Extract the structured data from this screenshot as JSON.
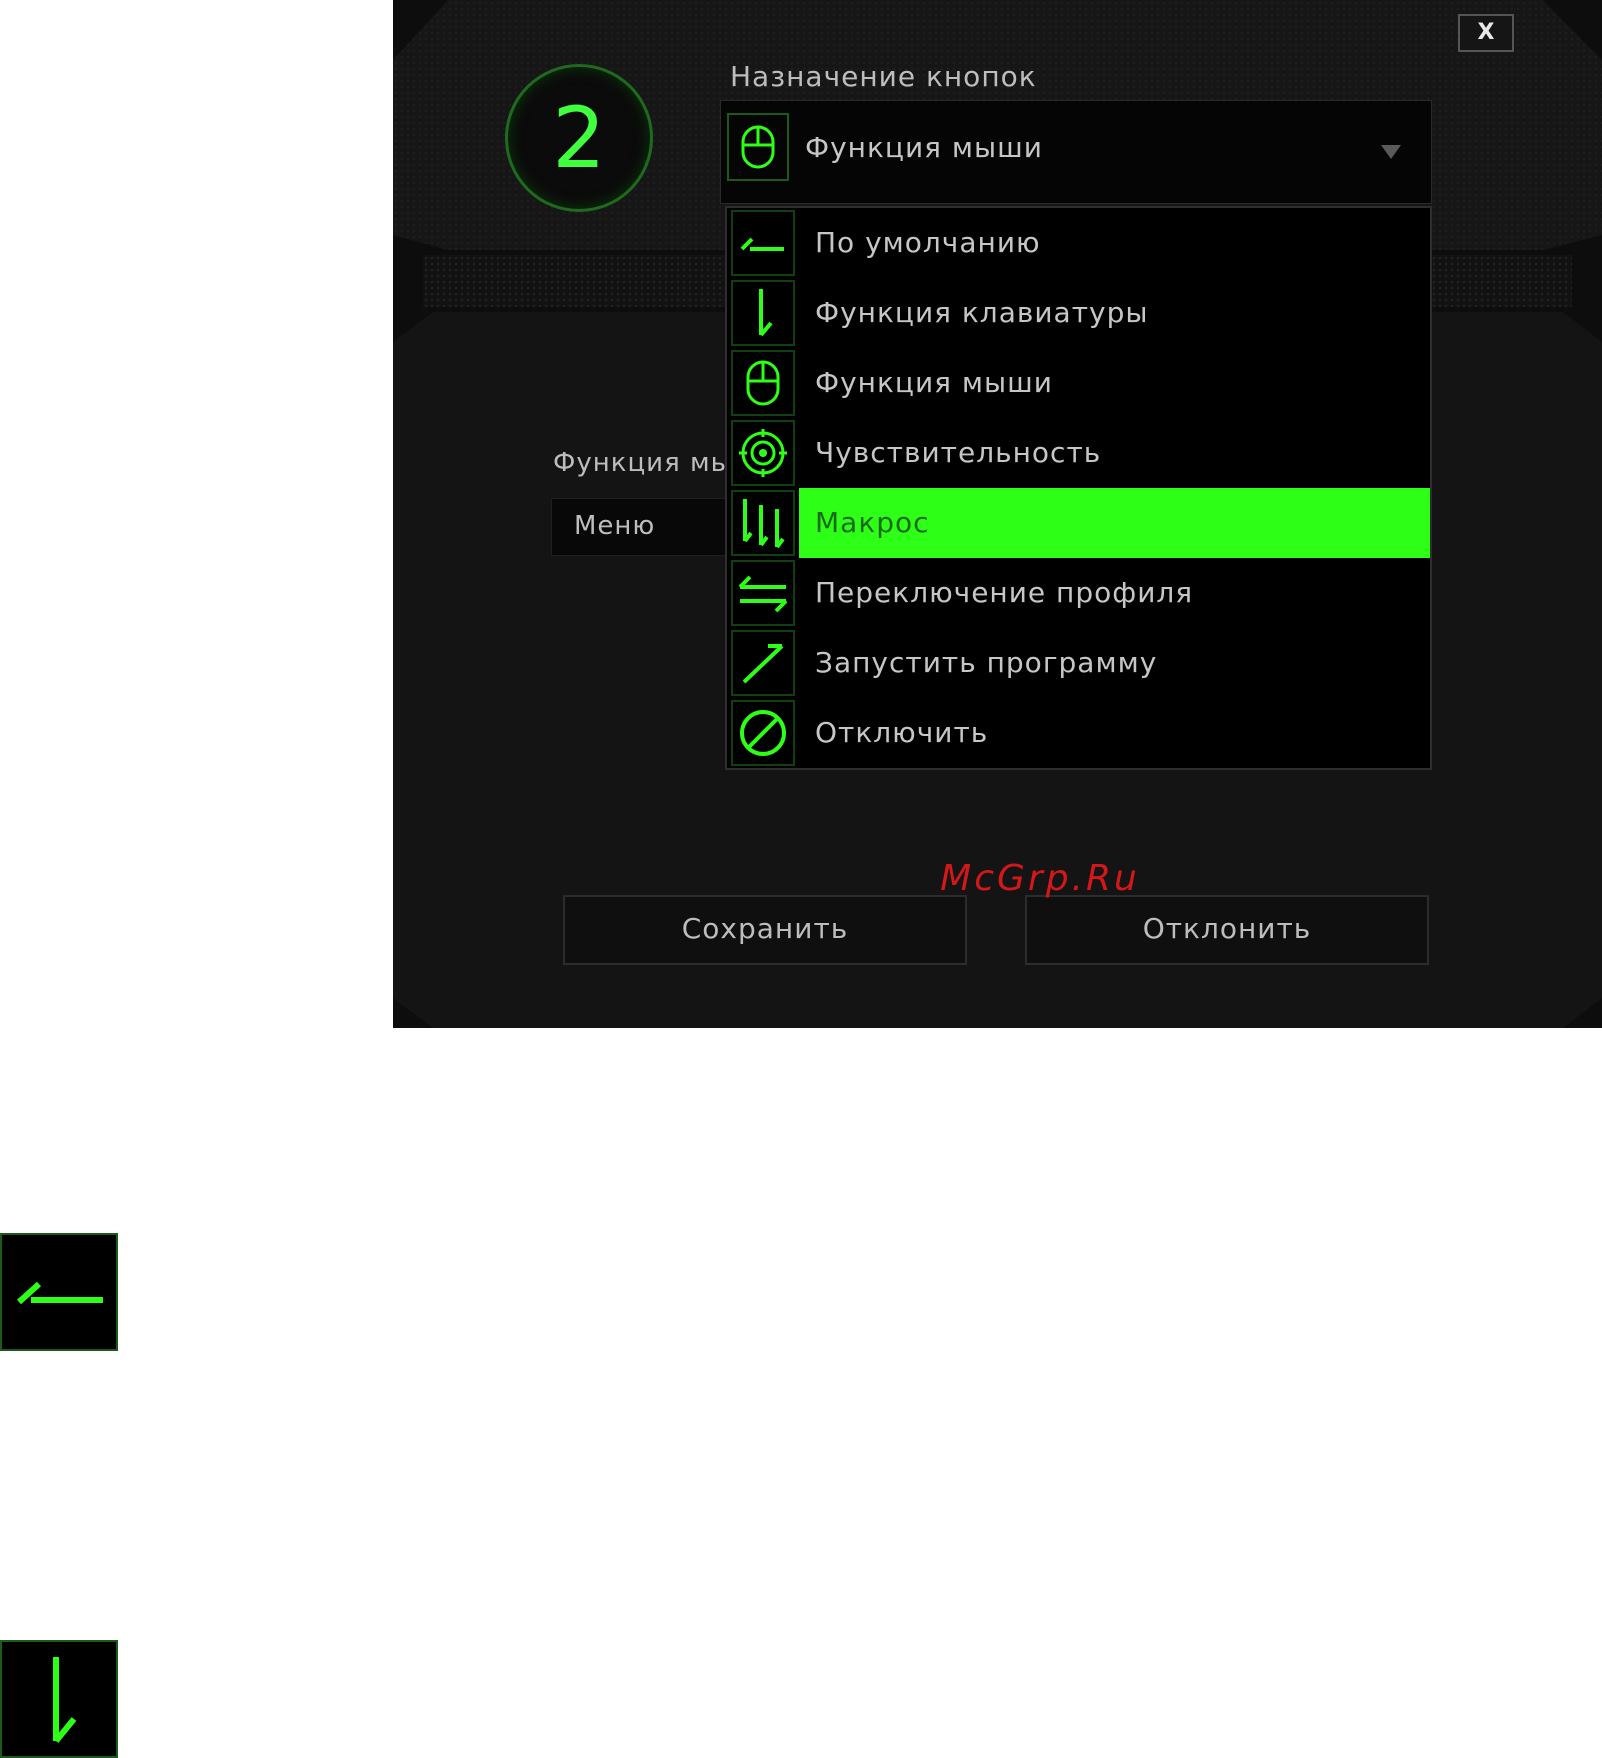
{
  "dialog": {
    "button_number": "2",
    "close_label": "X",
    "assign_title": "Назначение кнопок",
    "selected_value": "Функция мыши",
    "left_field_label": "Функция мы",
    "left_field_value": "Меню",
    "save_label": "Сохранить",
    "cancel_label": "Отклонить"
  },
  "dropdown": {
    "items": [
      {
        "label": "По умолчанию",
        "icon": "default-arrow-icon"
      },
      {
        "label": "Функция клавиатуры",
        "icon": "keyboard-arrow-icon"
      },
      {
        "label": "Функция мыши",
        "icon": "mouse-icon"
      },
      {
        "label": "Чувствительность",
        "icon": "target-icon"
      },
      {
        "label": "Макрос",
        "icon": "macro-arrows-icon"
      },
      {
        "label": "Переключение профиля",
        "icon": "swap-arrows-icon"
      },
      {
        "label": "Запустить программу",
        "icon": "launch-arrow-icon"
      },
      {
        "label": "Отключить",
        "icon": "disable-icon"
      }
    ],
    "active_index": 4
  },
  "watermark": "McGrp.Ru",
  "colors": {
    "accent": "#2dff16",
    "panel_bg": "#0d0d0d",
    "watermark": "#d21818"
  }
}
